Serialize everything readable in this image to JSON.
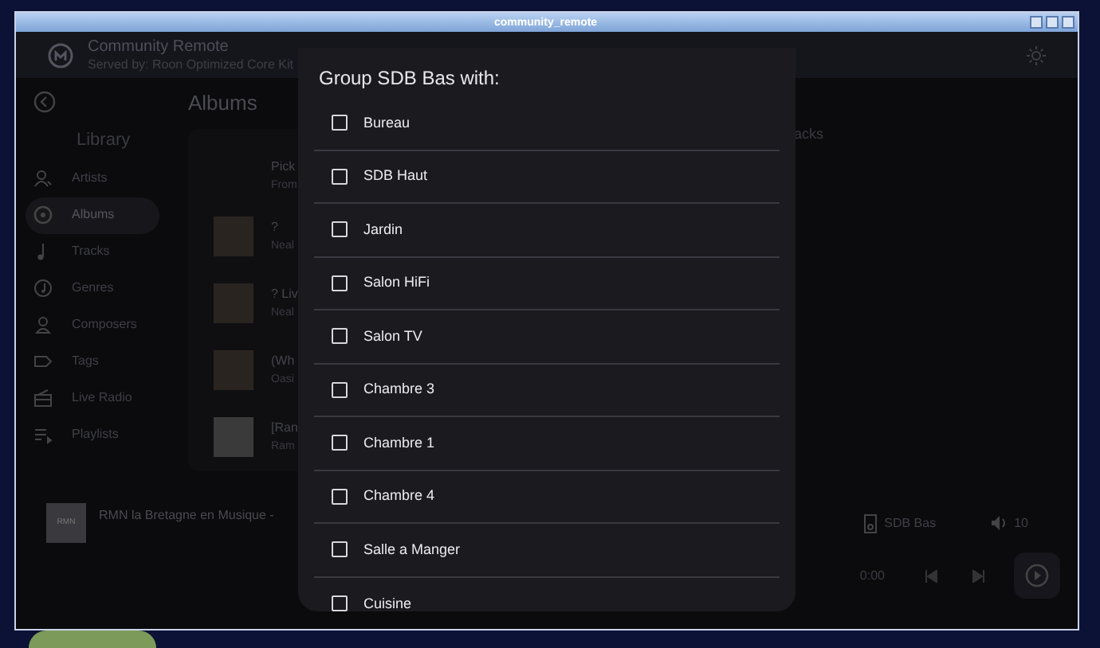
{
  "window": {
    "title": "community_remote"
  },
  "header": {
    "app_name": "Community Remote",
    "served_by": "Served by: Roon Optimized Core Kit"
  },
  "sidebar": {
    "heading": "Library",
    "items": [
      {
        "label": "Artists",
        "selected": false,
        "kind": "artist"
      },
      {
        "label": "Albums",
        "selected": true,
        "kind": "album"
      },
      {
        "label": "Tracks",
        "selected": false,
        "kind": "track"
      },
      {
        "label": "Genres",
        "selected": false,
        "kind": "genre"
      },
      {
        "label": "Composers",
        "selected": false,
        "kind": "composer"
      },
      {
        "label": "Tags",
        "selected": false,
        "kind": "tag"
      },
      {
        "label": "Live Radio",
        "selected": false,
        "kind": "radio"
      },
      {
        "label": "Playlists",
        "selected": false,
        "kind": "playlist"
      }
    ]
  },
  "main": {
    "title": "Albums",
    "column_3": "acks",
    "rows": [
      {
        "kind": "text",
        "title": "Pick",
        "subtitle": "From"
      },
      {
        "kind": "album",
        "title": "?",
        "subtitle": "Neal"
      },
      {
        "kind": "album",
        "title": "? Liv",
        "subtitle": "Neal"
      },
      {
        "kind": "album",
        "title": "(Wh",
        "subtitle": "Oasi"
      },
      {
        "kind": "album",
        "title": "[Ran",
        "subtitle": "Ram"
      }
    ]
  },
  "now_playing": {
    "station_logo": "RMN",
    "title": "RMN la Bretagne en Musique -",
    "zone": "SDB Bas",
    "volume": "10",
    "time": "0:00"
  },
  "dialog": {
    "title": "Group SDB Bas with:",
    "options": [
      {
        "label": "Bureau",
        "checked": false
      },
      {
        "label": "SDB Haut",
        "checked": false
      },
      {
        "label": "Jardin",
        "checked": false
      },
      {
        "label": "Salon HiFi",
        "checked": false
      },
      {
        "label": "Salon TV",
        "checked": false
      },
      {
        "label": "Chambre 3",
        "checked": false
      },
      {
        "label": "Chambre 1",
        "checked": false
      },
      {
        "label": "Chambre 4",
        "checked": false
      },
      {
        "label": "Salle a Manger",
        "checked": false
      },
      {
        "label": "Cuisine",
        "checked": false
      }
    ]
  }
}
